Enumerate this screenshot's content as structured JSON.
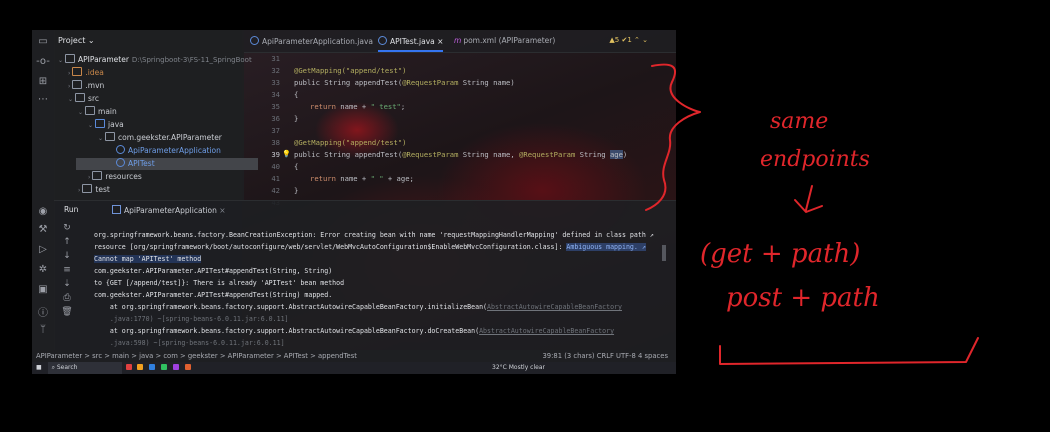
{
  "project": {
    "header": "Project",
    "tree": [
      {
        "label": "APIParameter",
        "path": "D:\\Springboot-3\\FS-11_SpringBoot"
      },
      {
        "label": ".idea"
      },
      {
        "label": ".mvn"
      },
      {
        "label": "src"
      },
      {
        "label": "main"
      },
      {
        "label": "java"
      },
      {
        "label": "com.geekster.APIParameter"
      },
      {
        "label": "ApiParameterApplication"
      },
      {
        "label": "APITest"
      },
      {
        "label": "resources"
      },
      {
        "label": "test"
      }
    ]
  },
  "tabs": [
    {
      "label": "ApiParameterApplication.java"
    },
    {
      "label": "APITest.java"
    },
    {
      "label": "pom.xml (APIParameter)"
    }
  ],
  "editor": {
    "warnings": "▲5  ✔1",
    "line_numbers": [
      "31",
      "32",
      "33",
      "34",
      "35",
      "36",
      "37",
      "38",
      "39",
      "40",
      "41",
      "42",
      "43"
    ],
    "lines": {
      "l32a": "@GetMapping(\"append/test\")",
      "l33a": "public String appendTest(",
      "l33b": "@RequestParam",
      "l33c": " String name)",
      "l34": "{",
      "l35a": "return",
      "l35b": " name + ",
      "l35c": "\" test\"",
      "l35d": ";",
      "l36": "}",
      "l38a": "@GetMapping(\"append/test\")",
      "l39a": "public String appendTest(",
      "l39b": "@RequestParam",
      "l39c": " String name, ",
      "l39d": "@R",
      "l39e": "equestParam",
      "l39f": " String ",
      "l39g": "age",
      "l39h": ")",
      "l40": "{",
      "l41a": "return",
      "l41b": " name + ",
      "l41c": "\" \"",
      "l41d": " + age;",
      "l42": "}"
    }
  },
  "run": {
    "title": "Run",
    "tab": "ApiParameterApplication",
    "console": [
      "org.springframework.beans.factory.BeanCreationException: Error creating bean with name 'requestMappingHandlerMapping' defined in class path ↗",
      "resource [org/springframework/boot/autoconfigure/web/servlet/WebMvcAutoConfiguration$EnableWebMvcConfiguration.class]: ",
      "Ambiguous mapping. ↗",
      "Cannot map 'APITest' method",
      "com.geekster.APIParameter.APITest#appendTest(String, String)",
      "to {GET [/append/test]}: There is already 'APITest' bean method",
      "com.geekster.APIParameter.APITest#appendTest(String) mapped.",
      "    at org.springframework.beans.factory.support.AbstractAutowireCapableBeanFactory.initializeBean(",
      "AbstractAutowireCapableBeanFactory",
      "    .java:1770) ~[spring-beans-6.0.11.jar:6.0.11]",
      "    at org.springframework.beans.factory.support.AbstractAutowireCapableBeanFactory.doCreateBean(",
      "AbstractAutowireCapableBeanFactory",
      "    .java:598) ~[spring-beans-6.0.11.jar:6.0.11]"
    ]
  },
  "status": {
    "breadcrumb": "APIParameter  >  src  >  main  >  java  >  com  >  geekster  >  APIParameter  >  APITest  >  appendTest",
    "right": "39:81 (3 chars)    CRLF    UTF-8    4 spaces"
  },
  "taskbar": {
    "search": "Search",
    "weather": "32°C Mostly clear"
  },
  "handwriting": {
    "line1": "same",
    "line2": "endpoints",
    "line3": "(get + path)",
    "line4": "post + path"
  },
  "colors": {
    "accent": "#3574f0",
    "ink": "#e0262b",
    "background": "#000000"
  }
}
